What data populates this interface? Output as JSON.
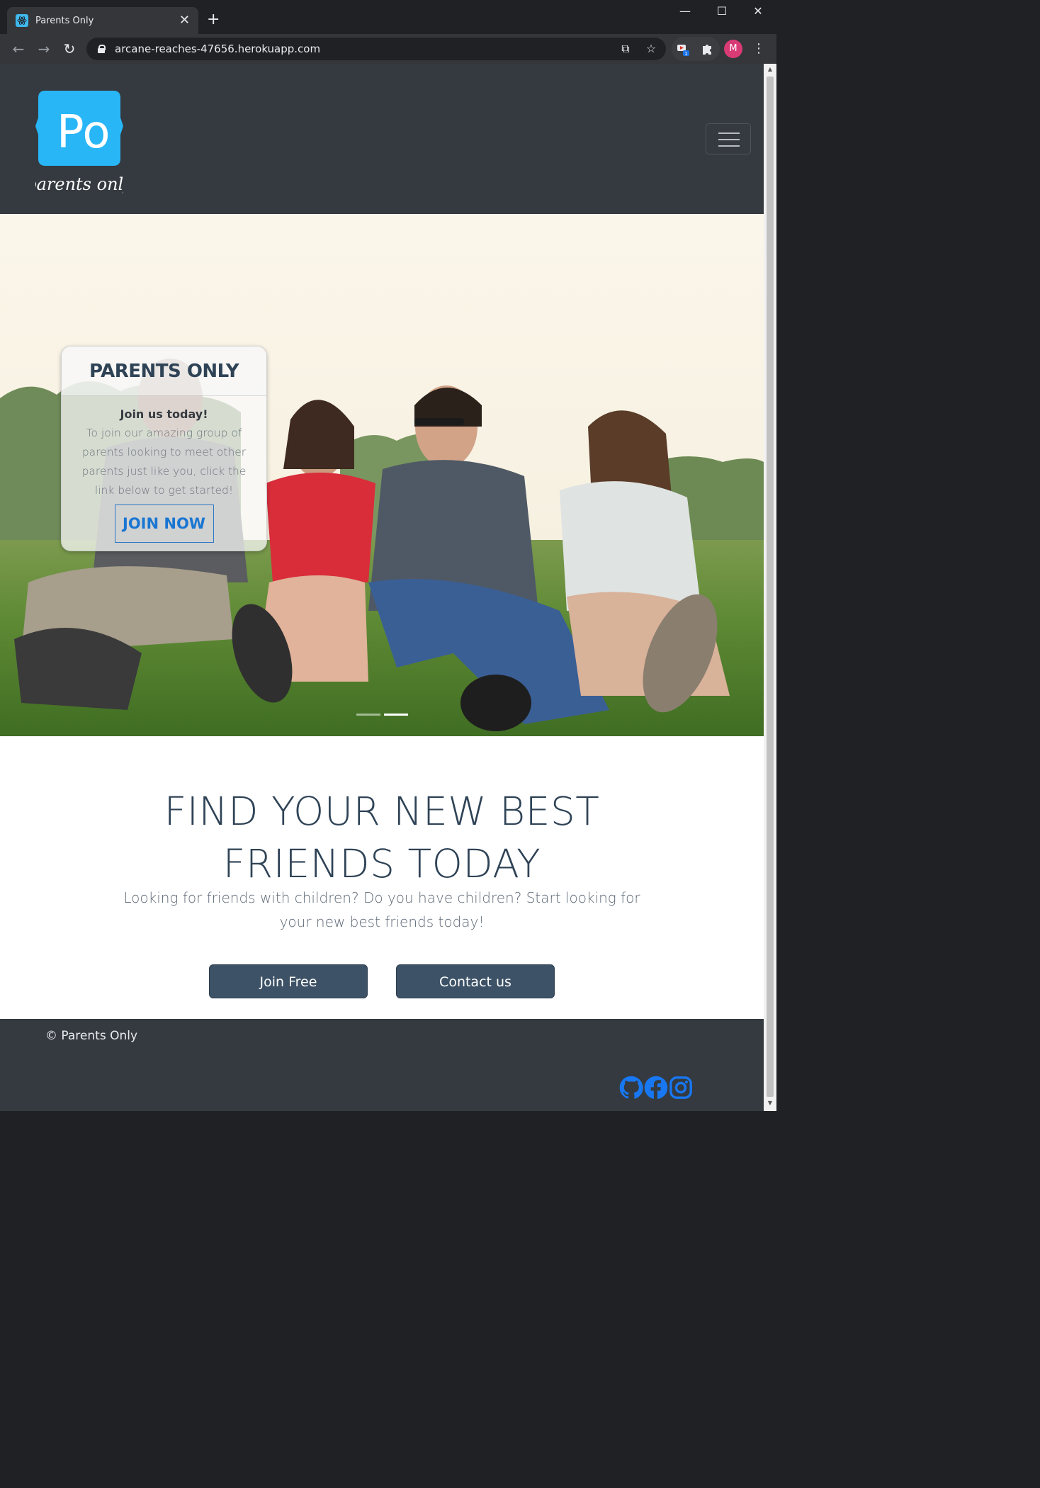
{
  "browser": {
    "tab_title": "Parents Only",
    "url": "arcane-reaches-47656.herokuapp.com",
    "profile_initial": "M",
    "extension_badge": "1"
  },
  "header": {
    "logo_text": "Po",
    "logo_tagline": "parents only"
  },
  "hero": {
    "card_title": "PARENTS ONLY",
    "card_subtitle": "Join us today!",
    "card_text": "To join our amazing group of parents looking to meet other parents just like you, click the link below to get started!",
    "cta_label": "JOIN NOW"
  },
  "main": {
    "heading_line1": "FIND YOUR NEW BEST",
    "heading_line2": "FRIENDS TODAY",
    "subtext": "Looking for friends with children? Do you have children? Start looking for your new best friends today!",
    "primary_button": "Join Free",
    "secondary_button": "Contact us"
  },
  "footer": {
    "copyright": "© Parents Only",
    "social": [
      "github-icon",
      "facebook-icon",
      "instagram-icon"
    ]
  },
  "colors": {
    "header_bg": "#343a40",
    "logo_blue": "#29b6f6",
    "heading_text": "#2f4356",
    "button_bg": "#3d5266",
    "link_blue": "#1877f2"
  }
}
